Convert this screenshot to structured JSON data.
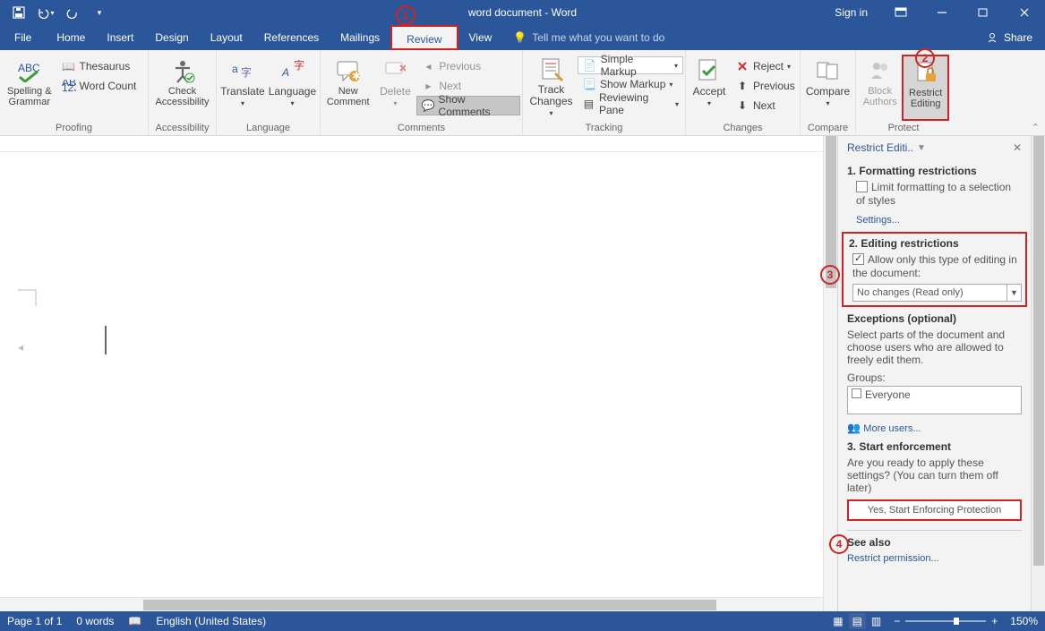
{
  "title": "word document  -  Word",
  "signin": "Sign in",
  "menus": {
    "file": "File",
    "home": "Home",
    "insert": "Insert",
    "design": "Design",
    "layout": "Layout",
    "references": "References",
    "mailings": "Mailings",
    "review": "Review",
    "view": "View"
  },
  "tellme": "Tell me what you want to do",
  "share": "Share",
  "groups": {
    "proofing": {
      "label": "Proofing",
      "spelling": "Spelling &\nGrammar",
      "thesaurus": "Thesaurus",
      "wordcount": "Word Count"
    },
    "accessibility": {
      "label": "Accessibility",
      "check": "Check\nAccessibility"
    },
    "language": {
      "label": "Language",
      "translate": "Translate",
      "lang": "Language"
    },
    "comments": {
      "label": "Comments",
      "new": "New\nComment",
      "delete": "Delete",
      "prev": "Previous",
      "next": "Next",
      "show": "Show Comments"
    },
    "tracking": {
      "label": "Tracking",
      "track": "Track\nChanges",
      "markup": "Simple Markup",
      "showmarkup": "Show Markup",
      "reviewing": "Reviewing Pane"
    },
    "changes": {
      "label": "Changes",
      "accept": "Accept",
      "reject": "Reject",
      "prev": "Previous",
      "next": "Next"
    },
    "compare": {
      "label": "Compare",
      "compare": "Compare"
    },
    "protect": {
      "label": "Protect",
      "block": "Block\nAuthors",
      "restrict": "Restrict\nEditing"
    }
  },
  "pane": {
    "title": "Restrict Editi..",
    "s1": {
      "h": "1. Formatting restrictions",
      "chk": "Limit formatting to a selection of styles",
      "settings": "Settings..."
    },
    "s2": {
      "h": "2. Editing restrictions",
      "chk": "Allow only this type of editing in the document:",
      "sel": "No changes (Read only)"
    },
    "ex": {
      "h": "Exceptions (optional)",
      "txt": "Select parts of the document and choose users who are allowed to freely edit them.",
      "groups": "Groups:",
      "everyone": "Everyone",
      "more": "More users..."
    },
    "s3": {
      "h": "3. Start enforcement",
      "txt": "Are you ready to apply these settings? (You can turn them off later)",
      "btn": "Yes, Start Enforcing Protection"
    },
    "see": {
      "h": "See also",
      "link": "Restrict permission..."
    }
  },
  "status": {
    "page": "Page 1 of 1",
    "words": "0 words",
    "lang": "English (United States)",
    "zoom": "150%"
  },
  "callouts": {
    "c1": "1",
    "c2": "2",
    "c3": "3",
    "c4": "4"
  }
}
